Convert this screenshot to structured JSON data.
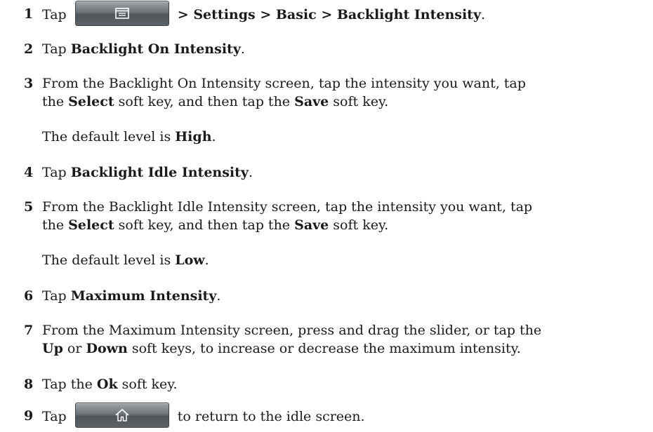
{
  "steps": [
    {
      "number": "1",
      "before": "Tap",
      "icon": "menu-icon",
      "path": "> Settings > Basic > Backlight Intensity",
      "end": "."
    },
    {
      "number": "2",
      "before": "Tap ",
      "bold1": "Backlight On Intensity",
      "end": "."
    },
    {
      "number": "3",
      "line1": "From the Backlight On Intensity screen, tap the intensity you want, tap",
      "l2_a": "the ",
      "l2_b": "Select",
      "l2_c": " soft key, and then tap the ",
      "l2_d": "Save",
      "l2_e": " soft key."
    },
    {
      "number": "4",
      "before": "Tap ",
      "bold1": "Backlight Idle Intensity",
      "end": "."
    },
    {
      "number": "5",
      "line1": "From the Backlight Idle Intensity screen, tap the intensity you want, tap",
      "l2_a": "the ",
      "l2_b": "Select",
      "l2_c": " soft key, and then tap the ",
      "l2_d": "Save",
      "l2_e": " soft key."
    },
    {
      "number": "6",
      "before": "Tap ",
      "bold1": "Maximum Intensity",
      "end": "."
    },
    {
      "number": "7",
      "line1": "From the Maximum Intensity screen, press and drag the slider, or tap the",
      "l2_a": "Up",
      "l2_b": " or ",
      "l2_c": "Down",
      "l2_d": " soft keys, to increase or decrease the maximum intensity."
    },
    {
      "number": "8",
      "before": "Tap the ",
      "bold1": "Ok",
      "end": " soft key."
    },
    {
      "number": "9",
      "before": "Tap",
      "icon": "home-icon",
      "after": "to return to the idle screen."
    }
  ],
  "notes": {
    "on_default_a": "The default level is ",
    "on_default_b": "High",
    "on_default_c": ".",
    "idle_default_a": "The default level is ",
    "idle_default_b": "Low",
    "idle_default_c": "."
  }
}
